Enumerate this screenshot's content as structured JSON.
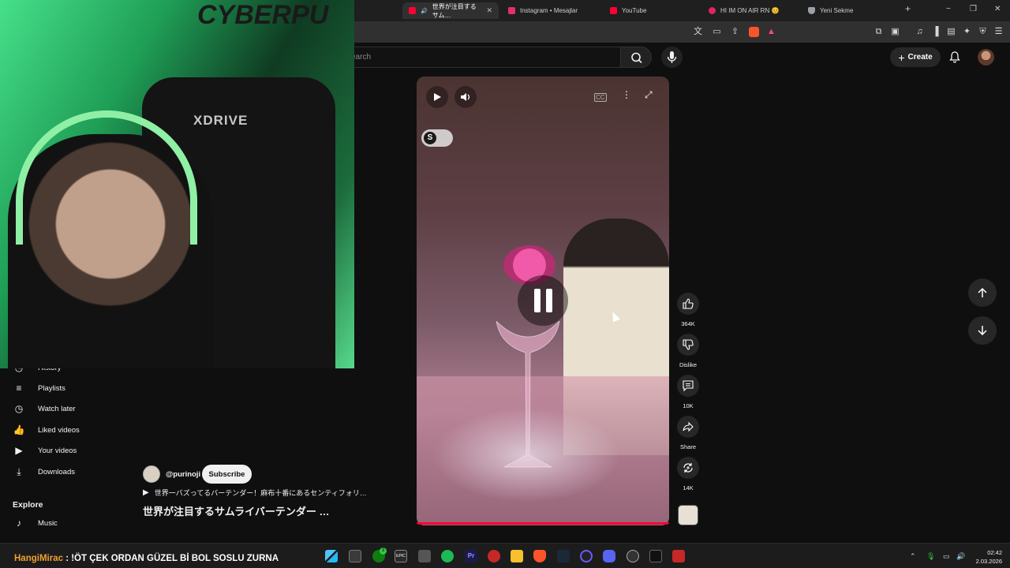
{
  "browser": {
    "tabs": [
      {
        "label": "世界が注目するサム…",
        "favicon_color": "#ff0033",
        "active": true
      },
      {
        "label": "Instagram • Mesajlar",
        "favicon_color": "#e1306c",
        "active": false
      },
      {
        "label": "YouTube",
        "favicon_color": "#ff0033",
        "active": false
      },
      {
        "label": "HI IM ON AIR RN 😊",
        "favicon_color": "#e0245e",
        "active": false
      },
      {
        "label": "Yeni Sekme",
        "favicon_color": "#9aa0a6",
        "active": false
      }
    ],
    "new_tab": "+",
    "window_controls": {
      "minimize": "−",
      "restore": "❐",
      "close": "✕"
    }
  },
  "youtube": {
    "search_placeholder": "earch",
    "create_label": "Create",
    "sidebar": {
      "items": [
        {
          "label": "History",
          "icon": "history-icon"
        },
        {
          "label": "Playlists",
          "icon": "playlist-icon"
        },
        {
          "label": "Watch later",
          "icon": "clock-icon"
        },
        {
          "label": "Liked videos",
          "icon": "thumbs-up-icon"
        },
        {
          "label": "Your videos",
          "icon": "video-icon"
        },
        {
          "label": "Downloads",
          "icon": "download-icon"
        }
      ],
      "explore_heading": "Explore",
      "explore_items": [
        {
          "label": "Music",
          "icon": "music-icon"
        }
      ]
    },
    "short": {
      "channel": "@purinoji",
      "subscribe_label": "Subscribe",
      "subtitle": "世界一バズってるバーテンダー！麻布十番にあるセンティフォリ…",
      "title": "世界が注目するサムライバーテンダー …",
      "overlay_badge": "S"
    },
    "actions": [
      {
        "name": "like",
        "label": "364K"
      },
      {
        "name": "dislike",
        "label": "Dislike"
      },
      {
        "name": "comments",
        "label": "10K"
      },
      {
        "name": "share",
        "label": "Share"
      },
      {
        "name": "remix",
        "label": "14K"
      }
    ]
  },
  "webcam": {
    "chair_brand": "XDRIVE",
    "wall_sign": "CYBERPU"
  },
  "taskbar": {
    "marquee_user": "HangiMirac",
    "marquee_text": ": !ÖT ÇEK ORDAN GÜZEL Bİ BOL SOSLU ZURNA",
    "time": "02:42",
    "date": "2.03.2026",
    "badge_count": "3"
  }
}
